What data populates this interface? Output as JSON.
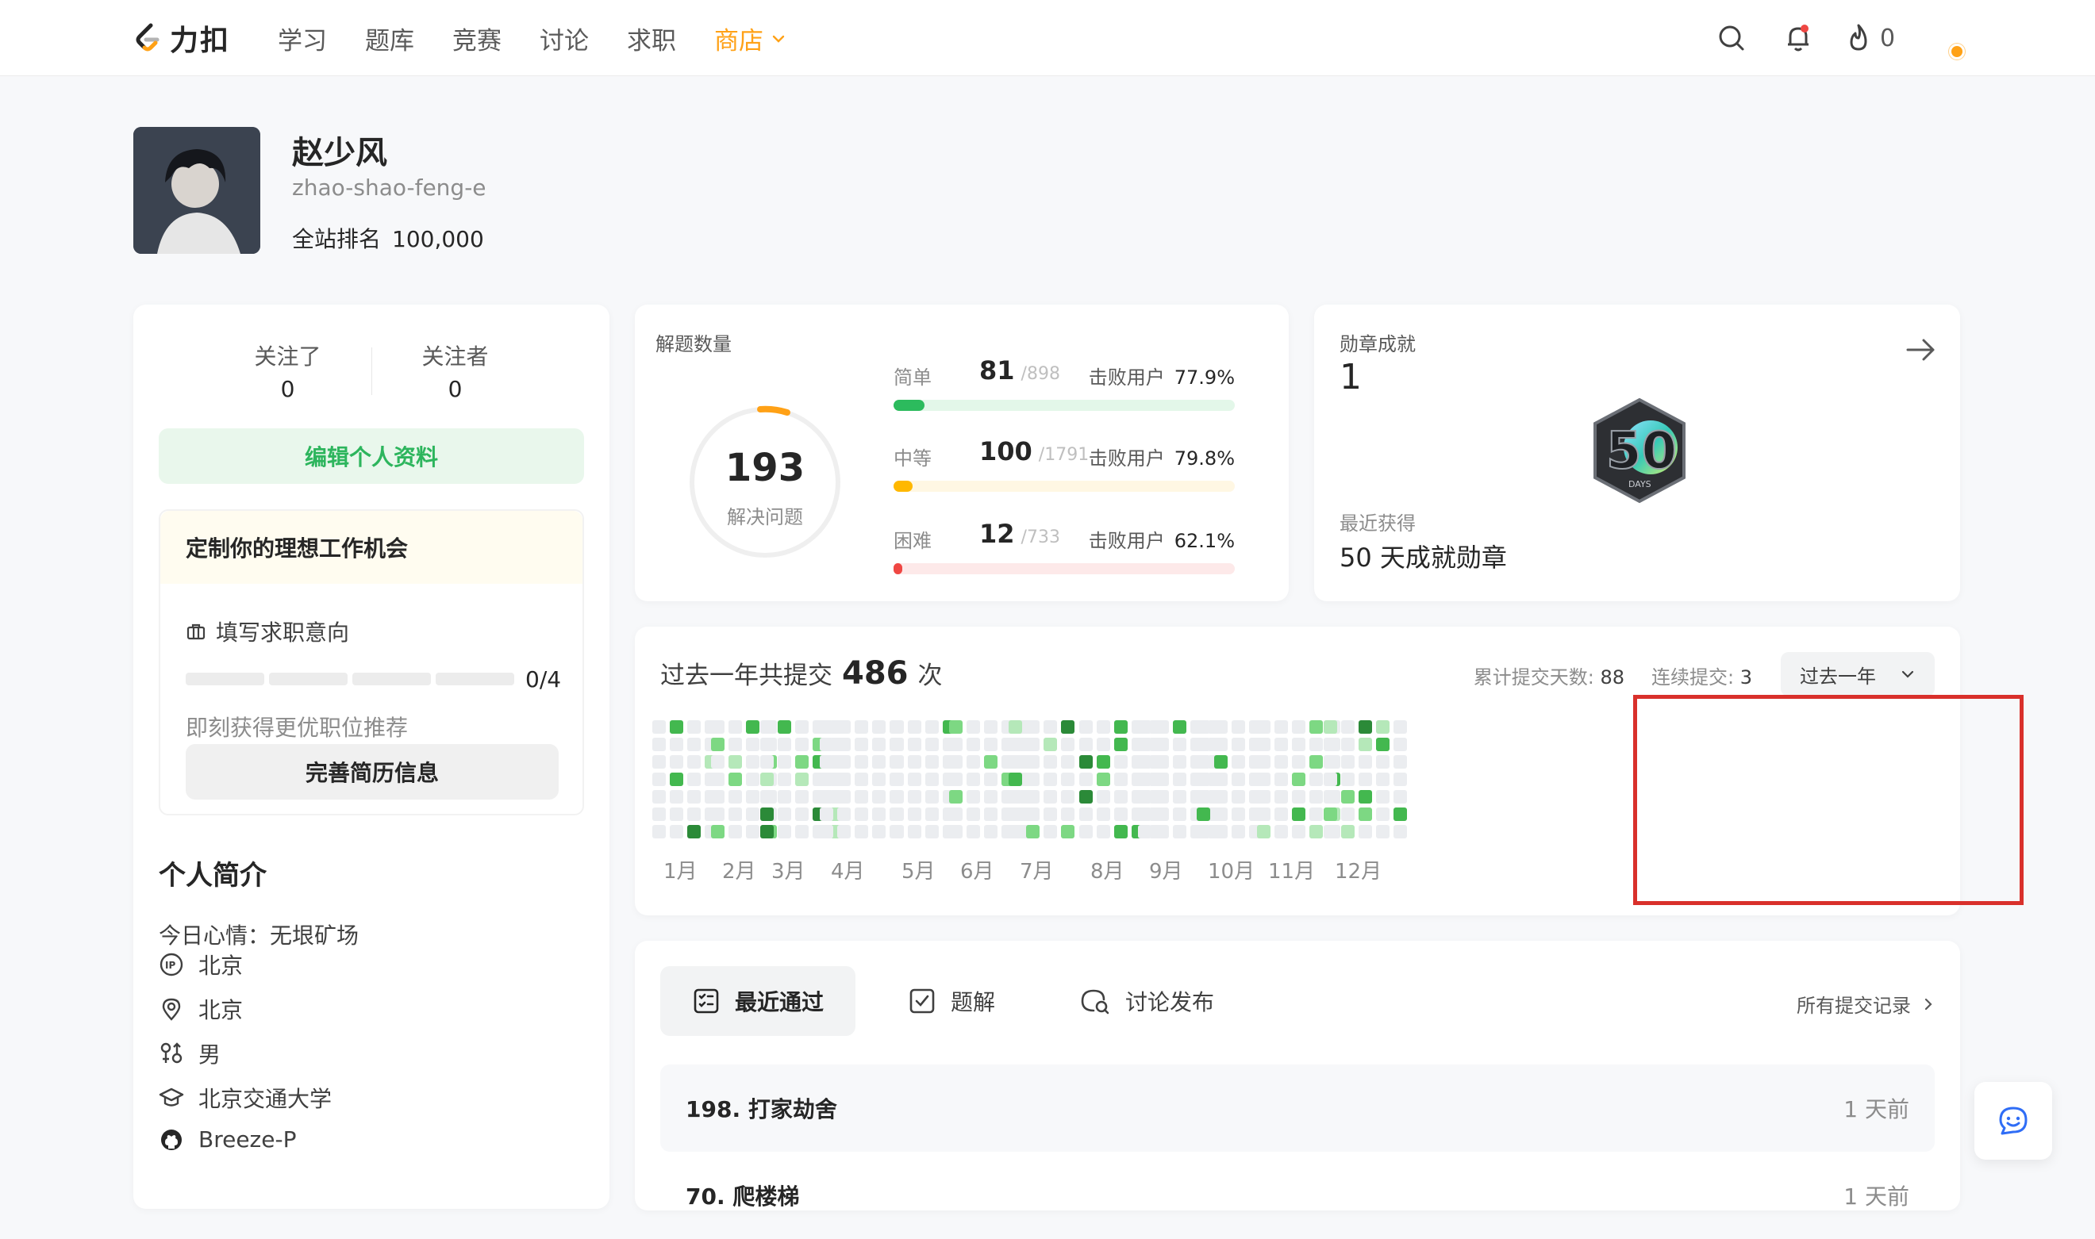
{
  "nav": {
    "logo_text": "力扣",
    "links": [
      "学习",
      "题库",
      "竞赛",
      "讨论",
      "求职"
    ],
    "shop": "商店",
    "fire_count": "0",
    "icons": [
      "search-icon",
      "bell-icon",
      "fire-icon",
      "chevron-down-icon"
    ]
  },
  "profile": {
    "name": "赵少风",
    "username": "zhao-shao-feng-e",
    "rank_label": "全站排名",
    "rank_value": "100,000"
  },
  "social": {
    "following_label": "关注了",
    "following": "0",
    "followers_label": "关注者",
    "followers": "0",
    "edit_button": "编辑个人资料"
  },
  "job": {
    "title": "定制你的理想工作机会",
    "fill_label": "填写求职意向",
    "progress": "0/4",
    "progress_fraction": 0,
    "hint": "即刻获得更优职位推荐",
    "button": "完善简历信息"
  },
  "bio": {
    "title": "个人简介",
    "mood": "今日心情：无垠矿场",
    "items": [
      {
        "icon": "ip-icon",
        "text": "北京"
      },
      {
        "icon": "location-icon",
        "text": "北京"
      },
      {
        "icon": "gender-icon",
        "text": "男"
      },
      {
        "icon": "school-icon",
        "text": "北京交通大学"
      },
      {
        "icon": "github-icon",
        "text": "Breeze-P"
      }
    ]
  },
  "solved": {
    "title": "解题数量",
    "total": "193",
    "total_label": "解决问题",
    "beat_label": "击败用户",
    "difficulties": [
      {
        "label": "简单",
        "count": "81",
        "total": "/898",
        "beat": "77.9%",
        "color": "#2cbb5d",
        "track": "#e3f7e9",
        "ratio": 0.09
      },
      {
        "label": "中等",
        "count": "100",
        "total": "/1791",
        "beat": "79.8%",
        "color": "#ffb800",
        "track": "#fff7e3",
        "ratio": 0.056
      },
      {
        "label": "困难",
        "count": "12",
        "total": "/733",
        "beat": "62.1%",
        "color": "#ef4743",
        "track": "#fde9e9",
        "ratio": 0.016
      }
    ]
  },
  "badge": {
    "title": "勋章成就",
    "count": "1",
    "recent_label": "最近获得",
    "recent_name": "50 天成就勋章",
    "badge_text": "50",
    "badge_sub": "DAYS"
  },
  "heatmap": {
    "title_prefix": "过去一年共提交",
    "total": "486",
    "title_suffix": "次",
    "days_label": "累计提交天数:",
    "days": "88",
    "streak_label": "连续提交:",
    "streak": "3",
    "range": "过去一年",
    "months": [
      "1月",
      "2月",
      "3月",
      "4月",
      "5月",
      "6月",
      "7月",
      "8月",
      "9月",
      "10月",
      "11月",
      "12月"
    ],
    "levels": [
      "#ebedf0",
      "#b5e8b9",
      "#7dd883",
      "#43b84f",
      "#2b8a38"
    ],
    "highlight_color": "#d9302b"
  },
  "activity": {
    "tabs": [
      {
        "icon": "checklist-icon",
        "label": "最近通过"
      },
      {
        "icon": "checkbox-icon",
        "label": "题解"
      },
      {
        "icon": "chat-search-icon",
        "label": "讨论发布"
      }
    ],
    "all_records": "所有提交记录",
    "rows": [
      {
        "title": "198. 打家劫舍",
        "time": "1 天前"
      },
      {
        "title": "70. 爬楼梯",
        "time": "1 天前"
      }
    ]
  }
}
